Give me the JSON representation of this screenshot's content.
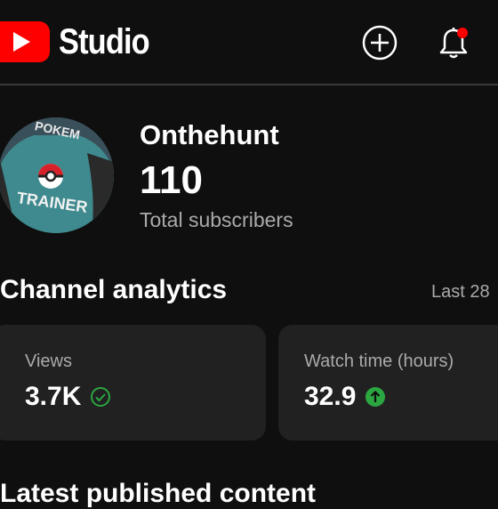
{
  "header": {
    "brand": "Studio",
    "logo_icon": "youtube-logo-icon",
    "create_icon": "plus-circle-icon",
    "notifications_icon": "bell-icon",
    "notification_dot_color": "#ff0000"
  },
  "channel": {
    "avatar_art": "POKEMON TRAINER",
    "name": "Onthehunt",
    "subscriber_count": "110",
    "subscriber_label": "Total subscribers"
  },
  "analytics": {
    "title": "Channel analytics",
    "period": "Last 28",
    "cards": [
      {
        "label": "Views",
        "value": "3.7K",
        "status_icon": "check-circle-icon",
        "status_color": "#2ba640"
      },
      {
        "label": "Watch time (hours)",
        "value": "32.9",
        "status_icon": "arrow-up-circle-icon",
        "status_color": "#2ba640"
      }
    ]
  },
  "latest": {
    "title": "Latest published content"
  },
  "colors": {
    "background": "#0f0f0f",
    "card": "#212121",
    "secondary_text": "#aaaaaa",
    "brand_red": "#ff0000"
  }
}
